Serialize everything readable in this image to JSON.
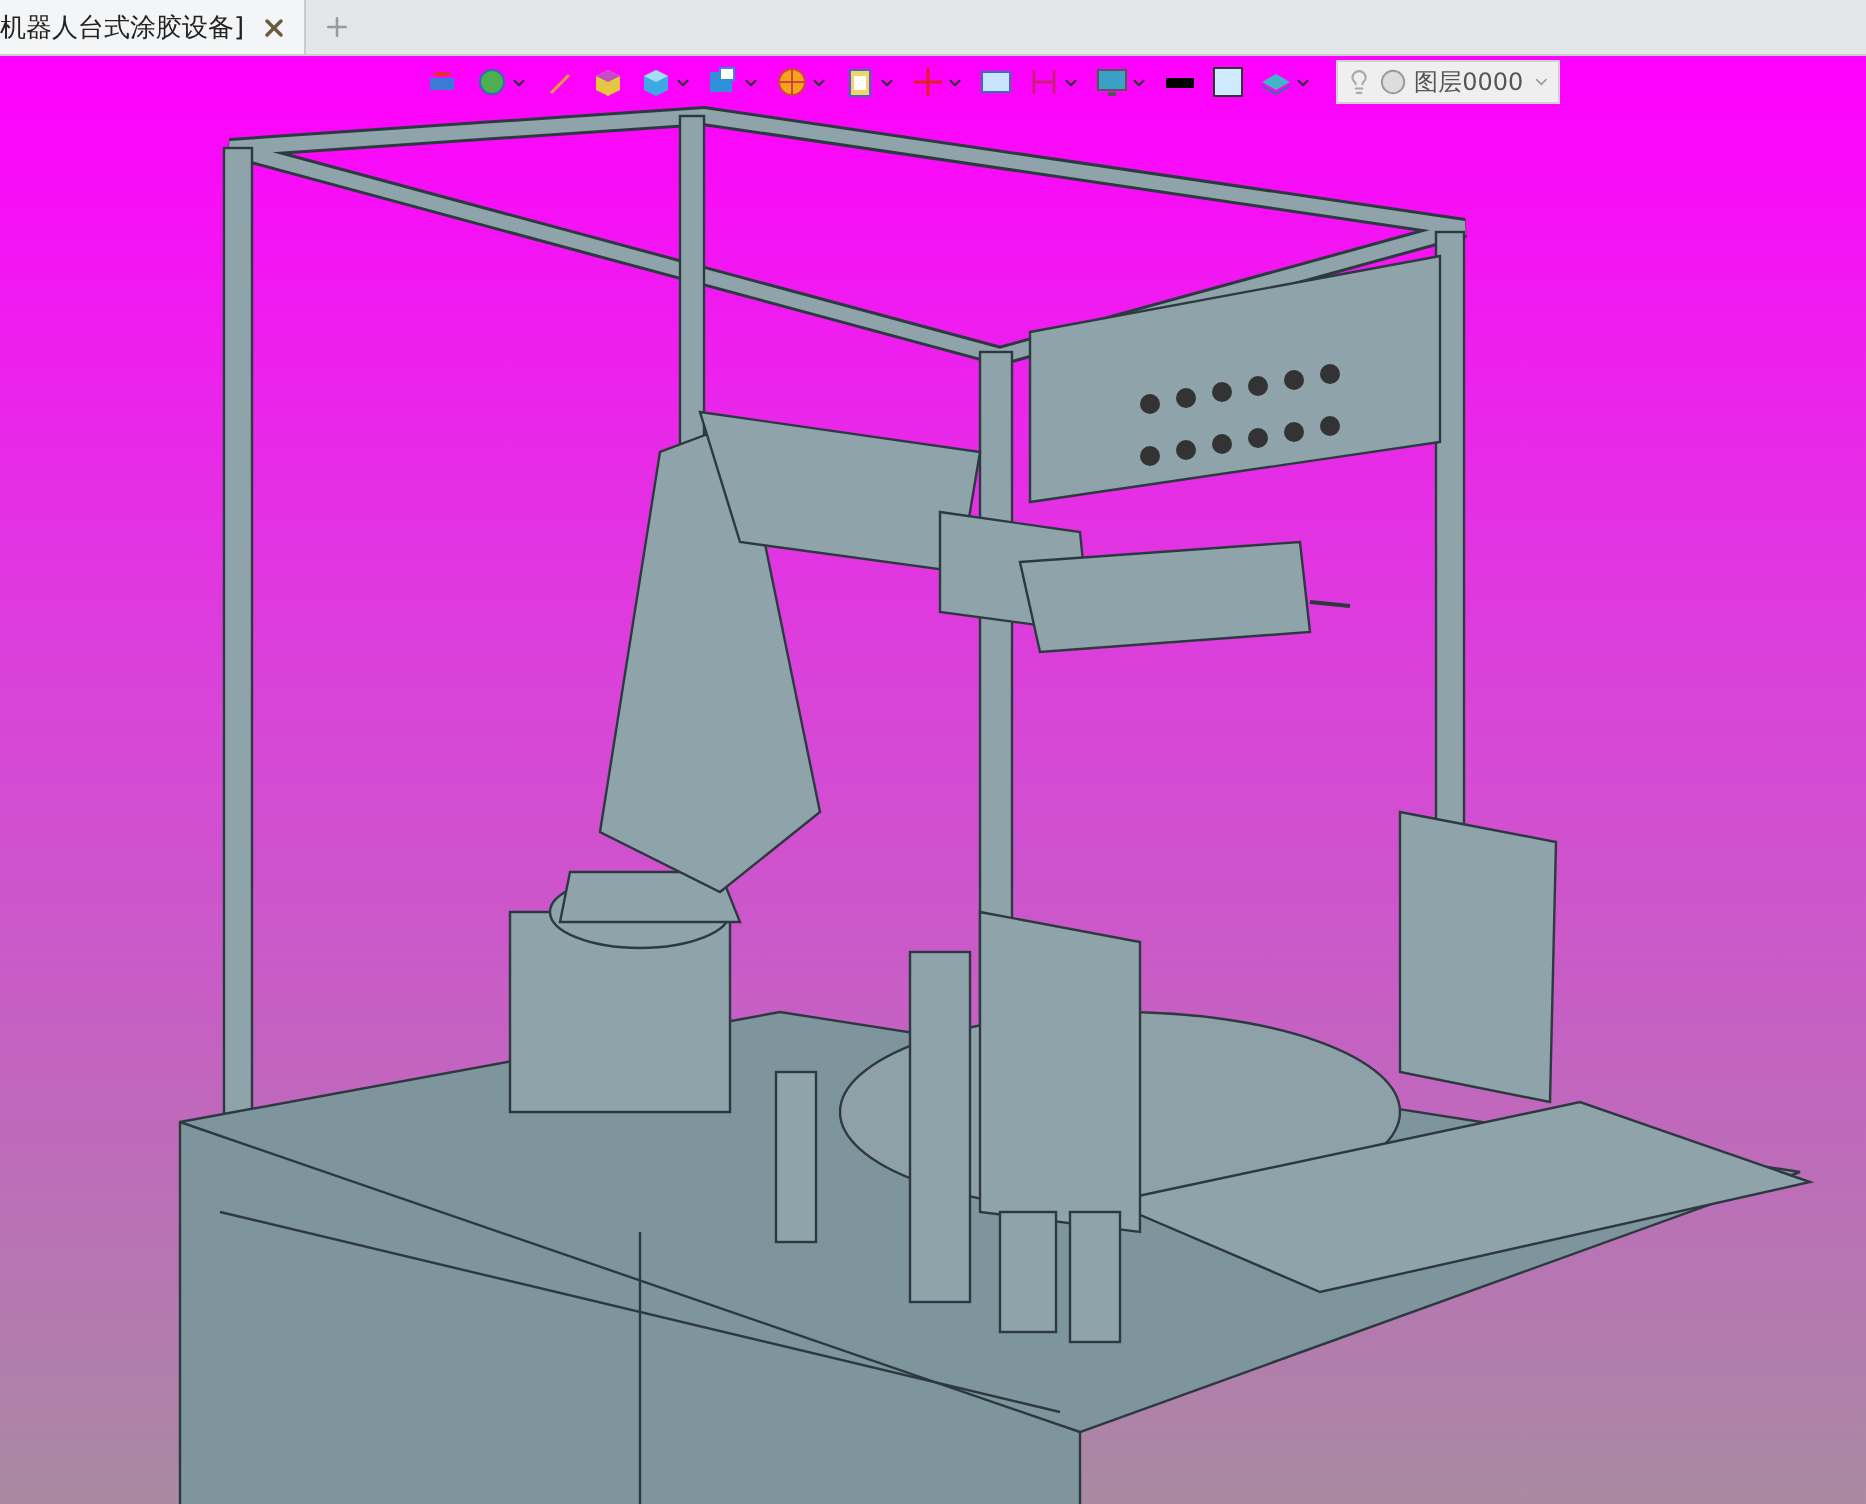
{
  "tabs": [
    {
      "label": "机器人台式涂胶设备]",
      "selected": true,
      "closable": true
    }
  ],
  "toolbar": {
    "tools": [
      {
        "kind": "sketch",
        "dropdown": false
      },
      {
        "kind": "globe",
        "dropdown": true
      },
      {
        "kind": "pen",
        "dropdown": false
      },
      {
        "kind": "box",
        "dropdown": false
      },
      {
        "kind": "cube",
        "dropdown": true
      },
      {
        "kind": "face",
        "dropdown": true
      },
      {
        "kind": "wheel",
        "dropdown": true
      },
      {
        "kind": "clipboard",
        "dropdown": true
      },
      {
        "kind": "cross",
        "dropdown": true
      },
      {
        "kind": "picture",
        "dropdown": false
      },
      {
        "kind": "bracket",
        "dropdown": true
      },
      {
        "kind": "monitor",
        "dropdown": true
      },
      {
        "kind": "line",
        "dropdown": false
      },
      {
        "kind": "fill",
        "dropdown": false
      },
      {
        "kind": "layers",
        "dropdown": true
      }
    ],
    "layer": {
      "value": "图层0000"
    }
  }
}
